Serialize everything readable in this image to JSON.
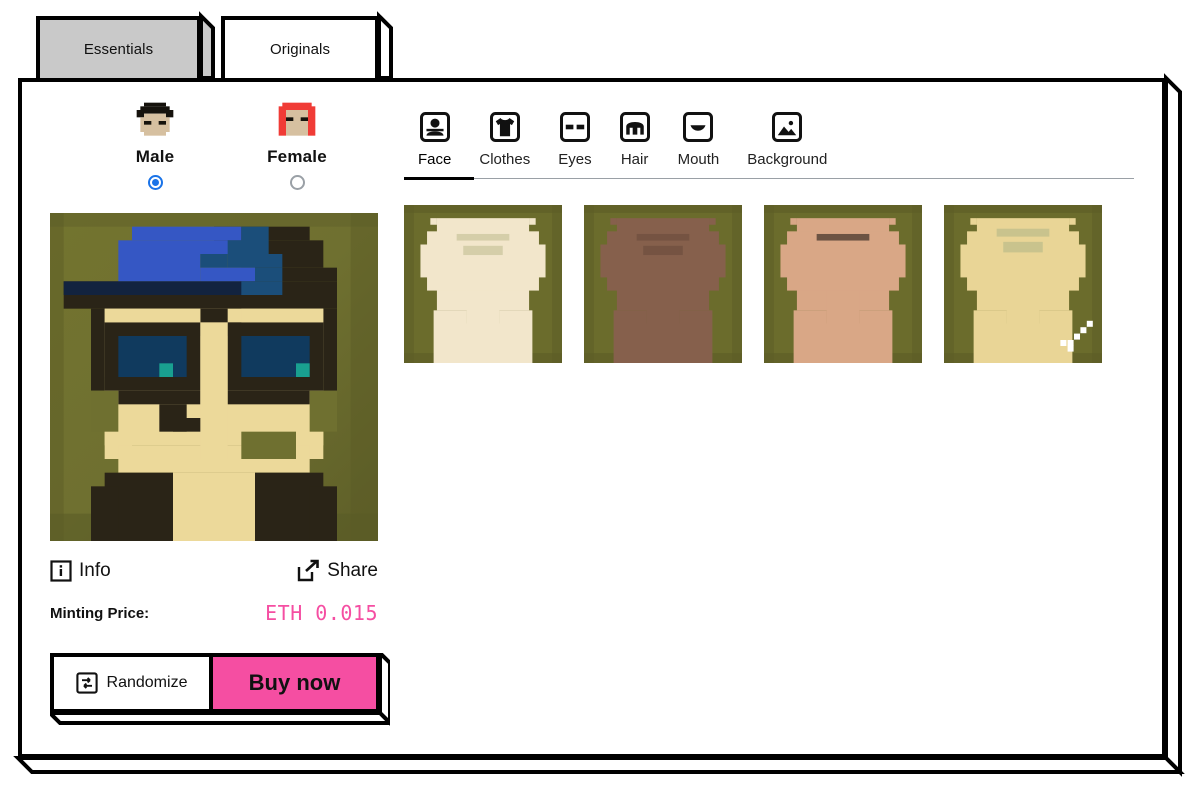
{
  "window_tabs": [
    {
      "label": "Essentials",
      "active": true
    },
    {
      "label": "Originals",
      "active": false
    }
  ],
  "gender": {
    "options": [
      {
        "label": "Male",
        "selected": true,
        "icon": "male-pixel-avatar"
      },
      {
        "label": "Female",
        "selected": false,
        "icon": "female-pixel-avatar"
      }
    ]
  },
  "preview": {
    "alt": "pixel-avatar-preview",
    "background_color": "#6b6c2c",
    "skin_color": "#ecd99a",
    "hat_color": "#3557c4",
    "hat_brim_color": "#12233f",
    "glasses_color": "#2a2417",
    "lens_color": "#103a5e",
    "eye_highlight_color": "#19a090"
  },
  "actions": {
    "info_label": "Info",
    "info_icon": "info-icon",
    "share_label": "Share",
    "share_icon": "share-external-icon"
  },
  "price": {
    "label": "Minting Price:",
    "value": "ETH 0.015",
    "accent_color": "#F54EA2"
  },
  "buttons": {
    "randomize_label": "Randomize",
    "randomize_icon": "randomize-icon",
    "buy_label": "Buy now",
    "buy_color": "#F54EA2"
  },
  "categories": [
    {
      "label": "Face",
      "icon": "face-icon",
      "active": true
    },
    {
      "label": "Clothes",
      "icon": "tshirt-icon",
      "active": false
    },
    {
      "label": "Eyes",
      "icon": "eyes-icon",
      "active": false
    },
    {
      "label": "Hair",
      "icon": "hair-icon",
      "active": false
    },
    {
      "label": "Mouth",
      "icon": "mouth-icon",
      "active": false
    },
    {
      "label": "Background",
      "icon": "background-icon",
      "active": false
    }
  ],
  "face_options": [
    {
      "name": "face-pale",
      "skin": "#f2e6cb",
      "bg": "#6b6c2c",
      "selected": false
    },
    {
      "name": "face-dark",
      "skin": "#86604c",
      "bg": "#6b6c2c",
      "selected": false
    },
    {
      "name": "face-tan",
      "skin": "#d9a786",
      "bg": "#6b6c2c",
      "selected": false
    },
    {
      "name": "face-golden",
      "skin": "#e9d596",
      "bg": "#6b6c2c",
      "selected": true
    }
  ],
  "cursor": {
    "name": "pixel-cursor-trail",
    "color": "#ffffff"
  }
}
